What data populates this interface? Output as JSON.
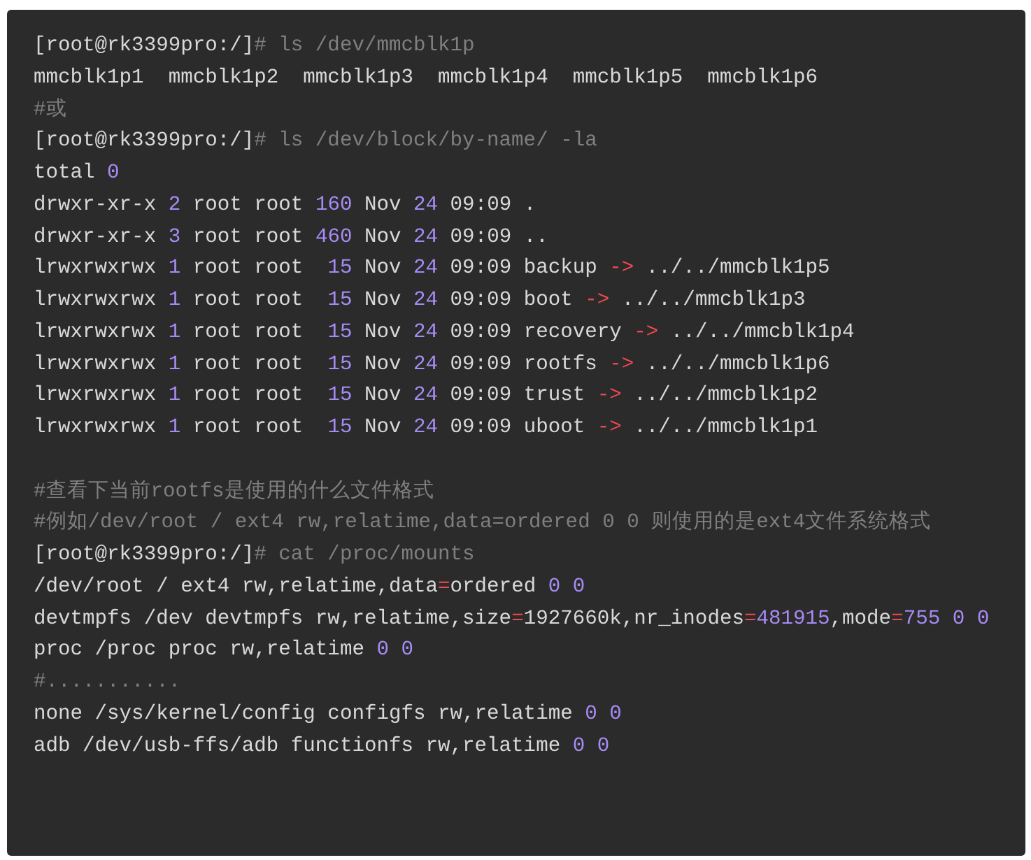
{
  "code_block": {
    "lines": [
      {
        "kind": "code",
        "segments": [
          {
            "kind": "text",
            "text": "[root@rk3399pro:/]"
          },
          {
            "kind": "comment",
            "text": "# ls /dev/mmcblk1p"
          }
        ]
      },
      {
        "kind": "code",
        "segments": [
          {
            "kind": "text",
            "text": "mmcblk1p1  mmcblk1p2  mmcblk1p3  mmcblk1p4  mmcblk1p5  mmcblk1p6"
          }
        ]
      },
      {
        "kind": "code",
        "segments": [
          {
            "kind": "comment",
            "text": "#或"
          }
        ]
      },
      {
        "kind": "code",
        "segments": [
          {
            "kind": "text",
            "text": "[root@rk3399pro:/]"
          },
          {
            "kind": "comment",
            "text": "# ls /dev/block/by-name/ -la"
          }
        ]
      },
      {
        "kind": "code",
        "segments": [
          {
            "kind": "text",
            "text": "total "
          },
          {
            "kind": "number",
            "text": "0"
          }
        ]
      },
      {
        "kind": "code",
        "segments": [
          {
            "kind": "text",
            "text": "drwxr-xr-x "
          },
          {
            "kind": "number",
            "text": "2"
          },
          {
            "kind": "text",
            "text": " root root "
          },
          {
            "kind": "number",
            "text": "160"
          },
          {
            "kind": "text",
            "text": " Nov "
          },
          {
            "kind": "number",
            "text": "24"
          },
          {
            "kind": "text",
            "text": " 09:09 ."
          }
        ]
      },
      {
        "kind": "code",
        "segments": [
          {
            "kind": "text",
            "text": "drwxr-xr-x "
          },
          {
            "kind": "number",
            "text": "3"
          },
          {
            "kind": "text",
            "text": " root root "
          },
          {
            "kind": "number",
            "text": "460"
          },
          {
            "kind": "text",
            "text": " Nov "
          },
          {
            "kind": "number",
            "text": "24"
          },
          {
            "kind": "text",
            "text": " 09:09 .."
          }
        ]
      },
      {
        "kind": "code",
        "segments": [
          {
            "kind": "text",
            "text": "lrwxrwxrwx "
          },
          {
            "kind": "number",
            "text": "1"
          },
          {
            "kind": "text",
            "text": " root root  "
          },
          {
            "kind": "number",
            "text": "15"
          },
          {
            "kind": "text",
            "text": " Nov "
          },
          {
            "kind": "number",
            "text": "24"
          },
          {
            "kind": "text",
            "text": " 09:09 backup "
          },
          {
            "kind": "operator",
            "text": "->"
          },
          {
            "kind": "text",
            "text": " ../../mmcblk1p5"
          }
        ]
      },
      {
        "kind": "code",
        "segments": [
          {
            "kind": "text",
            "text": "lrwxrwxrwx "
          },
          {
            "kind": "number",
            "text": "1"
          },
          {
            "kind": "text",
            "text": " root root  "
          },
          {
            "kind": "number",
            "text": "15"
          },
          {
            "kind": "text",
            "text": " Nov "
          },
          {
            "kind": "number",
            "text": "24"
          },
          {
            "kind": "text",
            "text": " 09:09 boot "
          },
          {
            "kind": "operator",
            "text": "->"
          },
          {
            "kind": "text",
            "text": " ../../mmcblk1p3"
          }
        ]
      },
      {
        "kind": "code",
        "segments": [
          {
            "kind": "text",
            "text": "lrwxrwxrwx "
          },
          {
            "kind": "number",
            "text": "1"
          },
          {
            "kind": "text",
            "text": " root root  "
          },
          {
            "kind": "number",
            "text": "15"
          },
          {
            "kind": "text",
            "text": " Nov "
          },
          {
            "kind": "number",
            "text": "24"
          },
          {
            "kind": "text",
            "text": " 09:09 recovery "
          },
          {
            "kind": "operator",
            "text": "->"
          },
          {
            "kind": "text",
            "text": " ../../mmcblk1p4"
          }
        ]
      },
      {
        "kind": "code",
        "segments": [
          {
            "kind": "text",
            "text": "lrwxrwxrwx "
          },
          {
            "kind": "number",
            "text": "1"
          },
          {
            "kind": "text",
            "text": " root root  "
          },
          {
            "kind": "number",
            "text": "15"
          },
          {
            "kind": "text",
            "text": " Nov "
          },
          {
            "kind": "number",
            "text": "24"
          },
          {
            "kind": "text",
            "text": " 09:09 rootfs "
          },
          {
            "kind": "operator",
            "text": "->"
          },
          {
            "kind": "text",
            "text": " ../../mmcblk1p6"
          }
        ]
      },
      {
        "kind": "code",
        "segments": [
          {
            "kind": "text",
            "text": "lrwxrwxrwx "
          },
          {
            "kind": "number",
            "text": "1"
          },
          {
            "kind": "text",
            "text": " root root  "
          },
          {
            "kind": "number",
            "text": "15"
          },
          {
            "kind": "text",
            "text": " Nov "
          },
          {
            "kind": "number",
            "text": "24"
          },
          {
            "kind": "text",
            "text": " 09:09 trust "
          },
          {
            "kind": "operator",
            "text": "->"
          },
          {
            "kind": "text",
            "text": " ../../mmcblk1p2"
          }
        ]
      },
      {
        "kind": "code",
        "segments": [
          {
            "kind": "text",
            "text": "lrwxrwxrwx "
          },
          {
            "kind": "number",
            "text": "1"
          },
          {
            "kind": "text",
            "text": " root root  "
          },
          {
            "kind": "number",
            "text": "15"
          },
          {
            "kind": "text",
            "text": " Nov "
          },
          {
            "kind": "number",
            "text": "24"
          },
          {
            "kind": "text",
            "text": " 09:09 uboot "
          },
          {
            "kind": "operator",
            "text": "->"
          },
          {
            "kind": "text",
            "text": " ../../mmcblk1p1"
          }
        ]
      },
      {
        "kind": "blank"
      },
      {
        "kind": "code",
        "segments": [
          {
            "kind": "comment",
            "text": "#查看下当前rootfs是使用的什么文件格式"
          }
        ]
      },
      {
        "kind": "code",
        "segments": [
          {
            "kind": "comment",
            "text": "#例如/dev/root / ext4 rw,relatime,data=ordered 0 0 则使用的是ext4文件系统格式"
          }
        ]
      },
      {
        "kind": "code",
        "segments": [
          {
            "kind": "text",
            "text": "[root@rk3399pro:/]"
          },
          {
            "kind": "comment",
            "text": "# cat /proc/mounts"
          }
        ]
      },
      {
        "kind": "code",
        "segments": [
          {
            "kind": "text",
            "text": "/dev/root / ext4 rw,relatime,data"
          },
          {
            "kind": "operator",
            "text": "="
          },
          {
            "kind": "text",
            "text": "ordered "
          },
          {
            "kind": "number",
            "text": "0 0"
          }
        ]
      },
      {
        "kind": "code",
        "segments": [
          {
            "kind": "text",
            "text": "devtmpfs /dev devtmpfs rw,relatime,size"
          },
          {
            "kind": "operator",
            "text": "="
          },
          {
            "kind": "text",
            "text": "1927660k,nr_inodes"
          },
          {
            "kind": "operator",
            "text": "="
          },
          {
            "kind": "number",
            "text": "481915"
          },
          {
            "kind": "text",
            "text": ",mode"
          },
          {
            "kind": "operator",
            "text": "="
          },
          {
            "kind": "number",
            "text": "755 0 0"
          }
        ]
      },
      {
        "kind": "code",
        "segments": [
          {
            "kind": "text",
            "text": "proc /proc proc rw,relatime "
          },
          {
            "kind": "number",
            "text": "0 0"
          }
        ]
      },
      {
        "kind": "code",
        "segments": [
          {
            "kind": "comment",
            "text": "#..........."
          }
        ]
      },
      {
        "kind": "code",
        "segments": [
          {
            "kind": "text",
            "text": "none /sys/kernel/config configfs rw,relatime "
          },
          {
            "kind": "number",
            "text": "0 0"
          }
        ]
      },
      {
        "kind": "code",
        "segments": [
          {
            "kind": "text",
            "text": "adb /dev/usb-ffs/adb functionfs rw,relatime "
          },
          {
            "kind": "number",
            "text": "0 0"
          }
        ]
      }
    ]
  }
}
